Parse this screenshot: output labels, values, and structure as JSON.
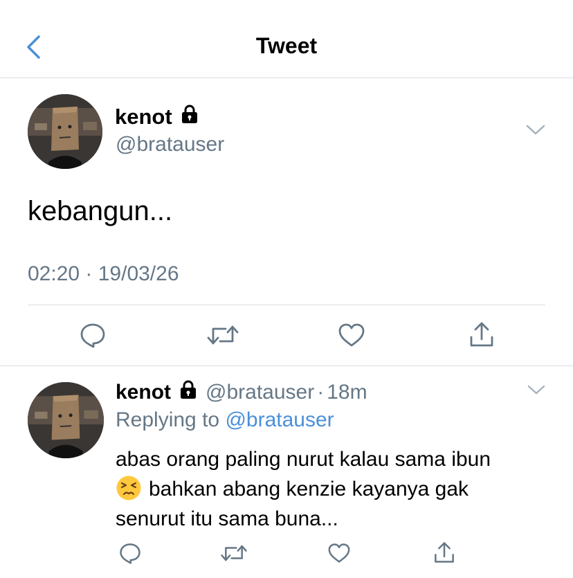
{
  "header": {
    "title": "Tweet",
    "back_icon": "chevron-left-icon",
    "accent": "#4a90d9"
  },
  "tweet": {
    "name": "kenot",
    "handle": "@bratauser",
    "text": "kebangun...",
    "timestamp": "02:20 · 19/03/26",
    "actions": [
      "reply-icon",
      "retweet-icon",
      "like-icon",
      "share-icon"
    ]
  },
  "reply": {
    "name": "kenot",
    "handle": "@bratauser",
    "dot": "·",
    "time": "18m",
    "replying_label": "Replying to",
    "replying_handle": "@bratauser",
    "text_line1": "abas orang paling nurut kalau sama ibun",
    "text_line2": "bahkan abang kenzie kayanya gak",
    "text_line3": "senurut itu sama buna...",
    "emoji": "persevering-face-emoji",
    "actions": [
      "reply-icon",
      "retweet-icon",
      "like-icon",
      "share-icon"
    ]
  },
  "colors": {
    "secondary_text": "#657786",
    "link": "#4a90d9",
    "divider": "#d8dde1",
    "icon": "#657786"
  }
}
